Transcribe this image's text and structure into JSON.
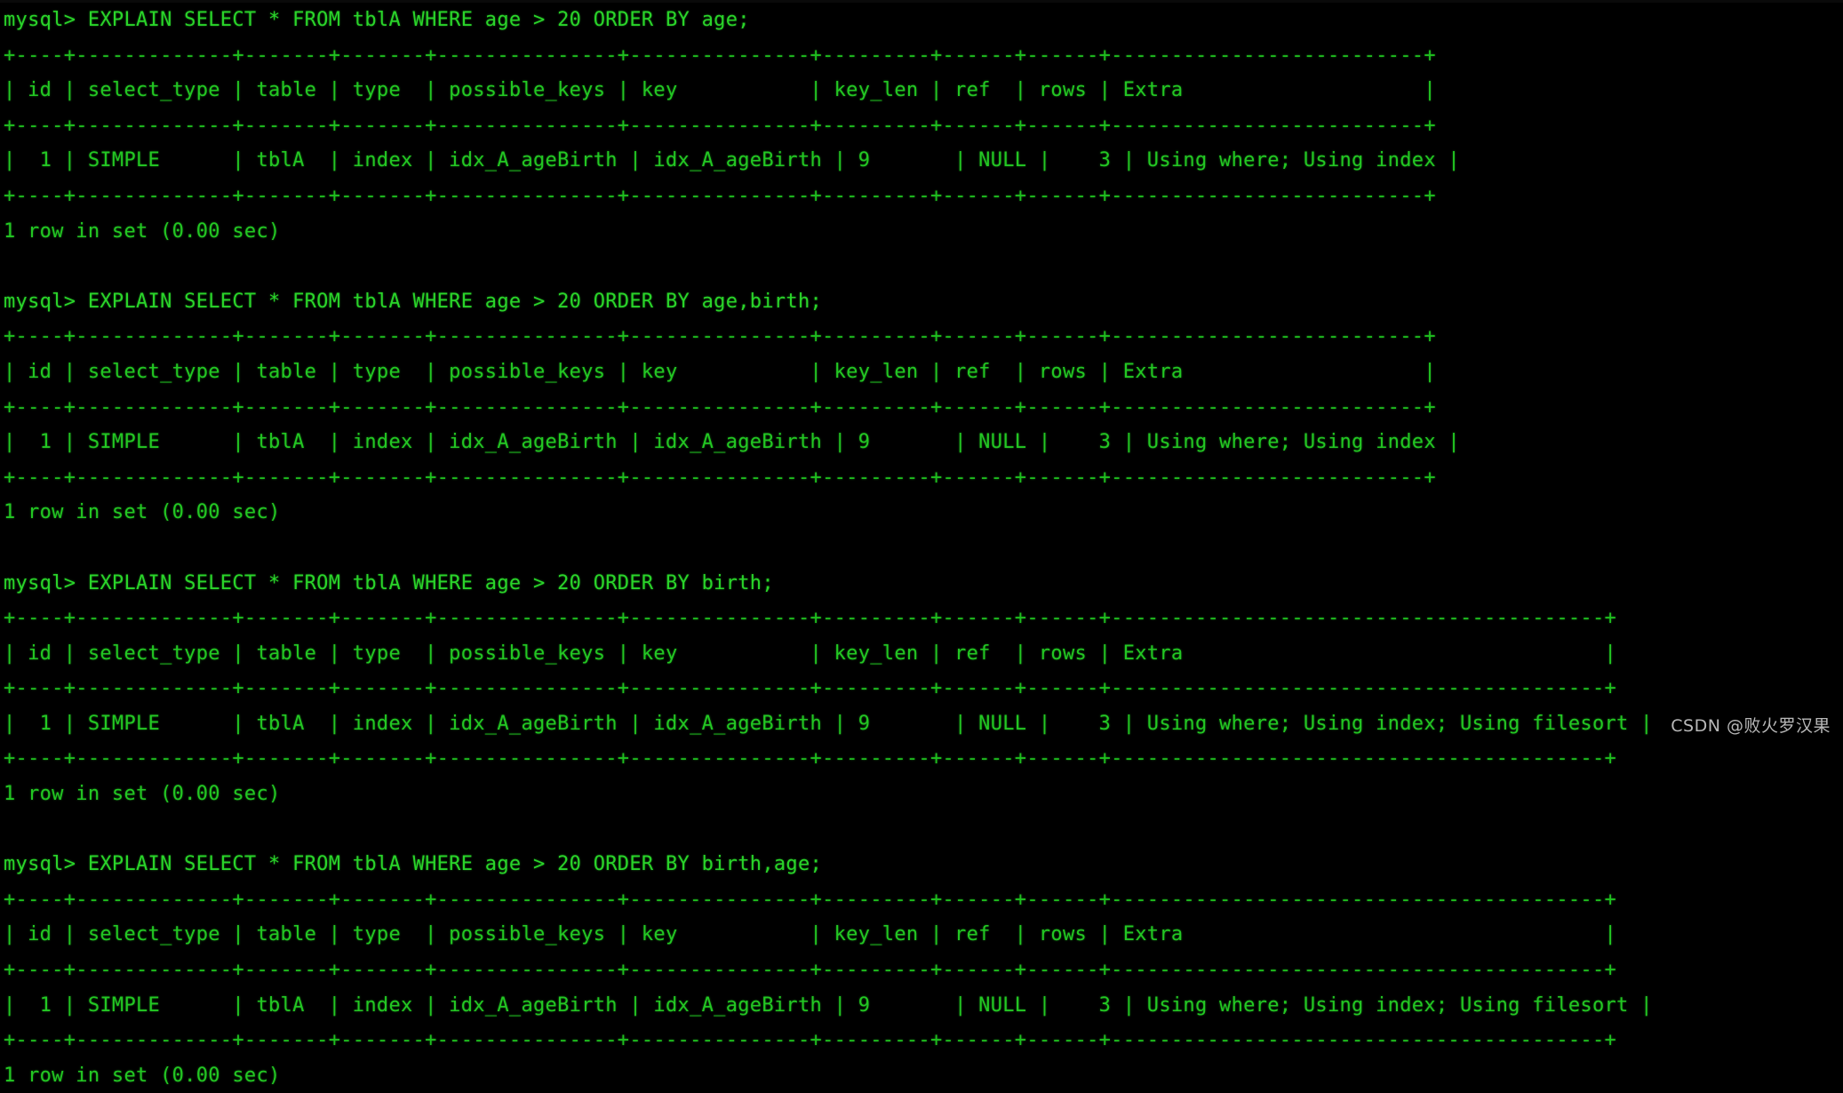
{
  "terminal": {
    "prompt": "mysql> ",
    "status_line": "1 row in set (0.00 sec)",
    "watermark": "CSDN @败火罗汉果",
    "foreground_color": "#23c723",
    "background_color": "#000000",
    "columns": [
      "id",
      "select_type",
      "table",
      "type",
      "possible_keys",
      "key",
      "key_len",
      "ref",
      "rows",
      "Extra"
    ]
  },
  "blocks": [
    {
      "query": "mysql> EXPLAIN SELECT * FROM tblA WHERE age > 20 ORDER BY age;",
      "sql": "EXPLAIN SELECT * FROM tblA WHERE age > 20 ORDER BY age;",
      "rule_top": "+----+-------------+-------+-------+---------------+---------------+---------+------+------+--------------------------+",
      "header": "| id | select_type | table | type  | possible_keys | key           | key_len | ref  | rows | Extra                    |",
      "rule_mid": "+----+-------------+-------+-------+---------------+---------------+---------+------+------+--------------------------+",
      "row": "|  1 | SIMPLE      | tblA  | index | idx_A_ageBirth | idx_A_ageBirth | 9       | NULL |    3 | Using where; Using index |",
      "rule_bottom": "+----+-------------+-------+-------+---------------+---------------+---------+------+------+--------------------------+",
      "status": "1 row in set (0.00 sec)",
      "values": {
        "id": "1",
        "select_type": "SIMPLE",
        "table": "tblA",
        "type": "index",
        "possible_keys": "idx_A_ageBirth",
        "key": "idx_A_ageBirth",
        "key_len": "9",
        "ref": "NULL",
        "rows": "3",
        "Extra": "Using where; Using index"
      }
    },
    {
      "query": "mysql> EXPLAIN SELECT * FROM tblA WHERE age > 20 ORDER BY age,birth;",
      "sql": "EXPLAIN SELECT * FROM tblA WHERE age > 20 ORDER BY age,birth;",
      "rule_top": "+----+-------------+-------+-------+---------------+---------------+---------+------+------+--------------------------+",
      "header": "| id | select_type | table | type  | possible_keys | key           | key_len | ref  | rows | Extra                    |",
      "rule_mid": "+----+-------------+-------+-------+---------------+---------------+---------+------+------+--------------------------+",
      "row": "|  1 | SIMPLE      | tblA  | index | idx_A_ageBirth | idx_A_ageBirth | 9       | NULL |    3 | Using where; Using index |",
      "rule_bottom": "+----+-------------+-------+-------+---------------+---------------+---------+------+------+--------------------------+",
      "status": "1 row in set (0.00 sec)",
      "values": {
        "id": "1",
        "select_type": "SIMPLE",
        "table": "tblA",
        "type": "index",
        "possible_keys": "idx_A_ageBirth",
        "key": "idx_A_ageBirth",
        "key_len": "9",
        "ref": "NULL",
        "rows": "3",
        "Extra": "Using where; Using index"
      }
    },
    {
      "query": "mysql> EXPLAIN SELECT * FROM tblA WHERE age > 20 ORDER BY birth;",
      "sql": "EXPLAIN SELECT * FROM tblA WHERE age > 20 ORDER BY birth;",
      "rule_top": "+----+-------------+-------+-------+---------------+---------------+---------+------+------+-----------------------------------------+",
      "header": "| id | select_type | table | type  | possible_keys | key           | key_len | ref  | rows | Extra                                   |",
      "rule_mid": "+----+-------------+-------+-------+---------------+---------------+---------+------+------+-----------------------------------------+",
      "row": "|  1 | SIMPLE      | tblA  | index | idx_A_ageBirth | idx_A_ageBirth | 9       | NULL |    3 | Using where; Using index; Using filesort |",
      "rule_bottom": "+----+-------------+-------+-------+---------------+---------------+---------+------+------+-----------------------------------------+",
      "status": "1 row in set (0.00 sec)",
      "values": {
        "id": "1",
        "select_type": "SIMPLE",
        "table": "tblA",
        "type": "index",
        "possible_keys": "idx_A_ageBirth",
        "key": "idx_A_ageBirth",
        "key_len": "9",
        "ref": "NULL",
        "rows": "3",
        "Extra": "Using where; Using index; Using filesort"
      }
    },
    {
      "query": "mysql> EXPLAIN SELECT * FROM tblA WHERE age > 20 ORDER BY birth,age;",
      "sql": "EXPLAIN SELECT * FROM tblA WHERE age > 20 ORDER BY birth,age;",
      "rule_top": "+----+-------------+-------+-------+---------------+---------------+---------+------+------+-----------------------------------------+",
      "header": "| id | select_type | table | type  | possible_keys | key           | key_len | ref  | rows | Extra                                   |",
      "rule_mid": "+----+-------------+-------+-------+---------------+---------------+---------+------+------+-----------------------------------------+",
      "row": "|  1 | SIMPLE      | tblA  | index | idx_A_ageBirth | idx_A_ageBirth | 9       | NULL |    3 | Using where; Using index; Using filesort |",
      "rule_bottom": "+----+-------------+-------+-------+---------------+---------------+---------+------+------+-----------------------------------------+",
      "status": "1 row in set (0.00 sec)",
      "values": {
        "id": "1",
        "select_type": "SIMPLE",
        "table": "tblA",
        "type": "index",
        "possible_keys": "idx_A_ageBirth",
        "key": "idx_A_ageBirth",
        "key_len": "9",
        "ref": "NULL",
        "rows": "3",
        "Extra": "Using where; Using index; Using filesort"
      }
    }
  ]
}
